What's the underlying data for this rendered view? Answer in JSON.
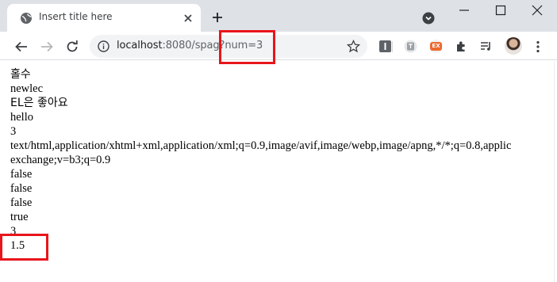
{
  "tab": {
    "title": "Insert title here"
  },
  "address_bar": {
    "host": "localhost",
    "path": ":8080/spag?num=3"
  },
  "page_lines": [
    "홀수",
    "newlec",
    "EL은 좋아요",
    "hello",
    "3",
    "text/html,application/xhtml+xml,application/xml;q=0.9,image/avif,image/webp,image/apng,*/*;q=0.8,applic",
    "exchange;v=b3;q=0.9",
    "false",
    "false",
    "false",
    "true",
    "3",
    "1.5"
  ],
  "extensions": {
    "badge_label": "EX"
  },
  "colors": {
    "highlight": "#e8151b",
    "tabstrip": "#dee1e6",
    "omnibox": "#f1f3f4"
  },
  "icons": [
    "globe-icon",
    "close-icon",
    "plus-icon",
    "back-icon",
    "forward-icon",
    "reload-icon",
    "info-icon",
    "star-icon",
    "puzzle-icon",
    "reading-list-icon",
    "kebab-menu-icon"
  ]
}
